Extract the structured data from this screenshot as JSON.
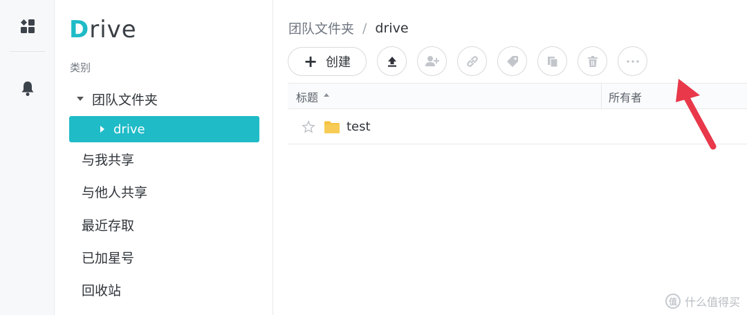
{
  "rail": {
    "icons": [
      "dashboard-icon",
      "bell-icon"
    ]
  },
  "sidebar": {
    "logo": {
      "first_letter": "D",
      "rest": "rive"
    },
    "category_label": "类别",
    "tree_root": "团队文件夹",
    "tree_child": "drive",
    "items": [
      {
        "label": "与我共享"
      },
      {
        "label": "与他人共享"
      },
      {
        "label": "最近存取"
      },
      {
        "label": "已加星号"
      },
      {
        "label": "回收站"
      }
    ]
  },
  "breadcrumb": {
    "parent": "团队文件夹",
    "separator": "/",
    "current": "drive"
  },
  "toolbar": {
    "create_label": "创建",
    "buttons": [
      "upload-icon",
      "share-user-icon",
      "link-icon",
      "tag-icon",
      "copy-icon",
      "trash-icon",
      "more-icon"
    ]
  },
  "table": {
    "columns": [
      "标题",
      "所有者"
    ],
    "rows": [
      {
        "name": "test",
        "type": "folder",
        "starred": false
      }
    ]
  },
  "watermark": {
    "badge": "值",
    "text": "什么值得买"
  },
  "colors": {
    "accent": "#1fbbc7",
    "folder": "#f5c342",
    "arrow": "#e8384a"
  }
}
